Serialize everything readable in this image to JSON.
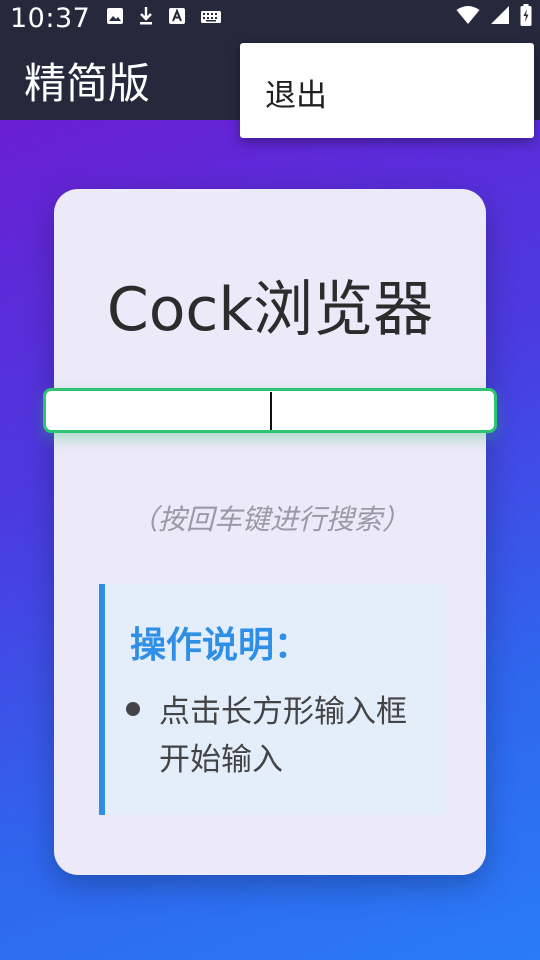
{
  "status_bar": {
    "time": "10:37",
    "left_icons": [
      "image-icon",
      "download-icon",
      "font-icon",
      "keyboard-icon"
    ],
    "right_icons": [
      "wifi-icon",
      "signal-icon",
      "battery-icon"
    ]
  },
  "app_bar": {
    "title": "精简版"
  },
  "overflow_menu": {
    "items": [
      {
        "label": "退出"
      }
    ]
  },
  "card": {
    "title": "Cock浏览器",
    "search": {
      "value": "",
      "placeholder": ""
    },
    "hint": "（按回车键进行搜索）",
    "instructions": {
      "title": "操作说明：",
      "items": [
        "点击长方形输入框开始输入"
      ]
    }
  },
  "colors": {
    "app_bar_bg": "#26283c",
    "gradient_start": "#7416d0",
    "gradient_end": "#2a7bf8",
    "card_bg": "#ece9f8",
    "search_border": "#2ec474",
    "instructions_accent": "#2f8fe6"
  }
}
